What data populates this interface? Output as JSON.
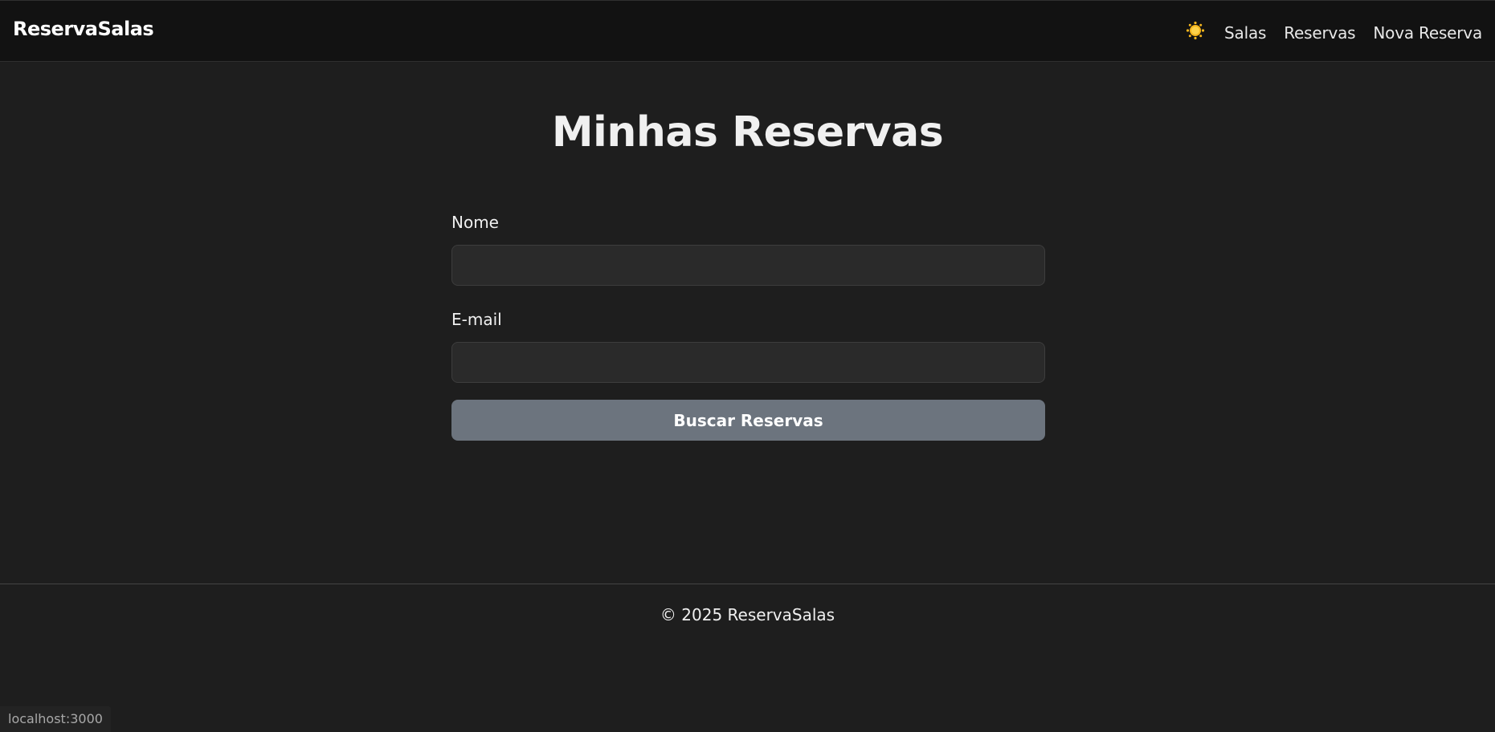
{
  "navbar": {
    "brand": "ReservaSalas",
    "theme_icon": "sun-icon",
    "links": [
      "Salas",
      "Reservas",
      "Nova Reserva"
    ]
  },
  "main": {
    "title": "Minhas Reservas",
    "form": {
      "name_label": "Nome",
      "name_value": "",
      "email_label": "E-mail",
      "email_value": "",
      "submit_label": "Buscar Reservas"
    }
  },
  "footer": {
    "text": "© 2025 ReservaSalas"
  },
  "status_bar": {
    "url": "localhost:3000"
  },
  "colors": {
    "background": "#1e1e1e",
    "navbar_background": "#121212",
    "input_background": "#2a2a2a",
    "button_background": "#6c747e",
    "sun_icon": "#f5b51c"
  }
}
